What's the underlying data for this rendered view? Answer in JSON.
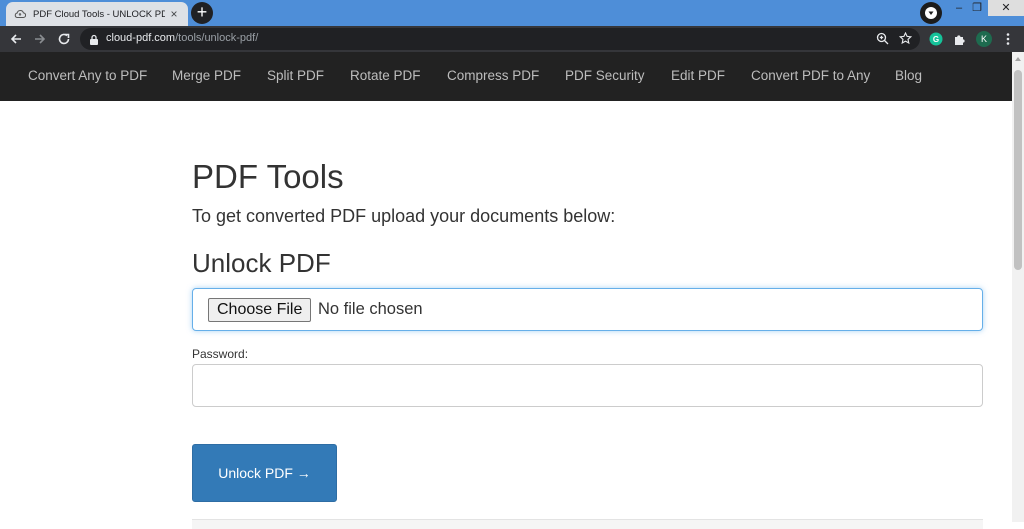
{
  "browser": {
    "tab_title": "PDF Cloud Tools - UNLOCK PDF",
    "tab_close": "×",
    "new_tab": "+",
    "url_host": "cloud-pdf.com",
    "url_path": "/tools/unlock-pdf/",
    "profile_initial": "K",
    "extension_initial": "G",
    "window_controls": {
      "minimize": "–",
      "restore": "❐",
      "close": "✕"
    }
  },
  "site_nav": {
    "items": [
      "Convert Any to PDF",
      "Merge PDF",
      "Split PDF",
      "Rotate PDF",
      "Compress PDF",
      "PDF Security",
      "Edit PDF",
      "Convert PDF to Any",
      "Blog"
    ]
  },
  "main": {
    "heading": "PDF Tools",
    "subheading": "To get converted PDF upload your documents below:",
    "tool_heading": "Unlock PDF",
    "file_button": "Choose File",
    "file_status": "No file chosen",
    "password_label": "Password:",
    "password_value": "",
    "submit_label": "Unlock PDF →"
  },
  "colors": {
    "titlebar": "#4e8ed8",
    "toolbar": "#35363a",
    "site_nav_bg": "#222222",
    "accent_button": "#337ab7",
    "focus_border": "#66afe9"
  }
}
